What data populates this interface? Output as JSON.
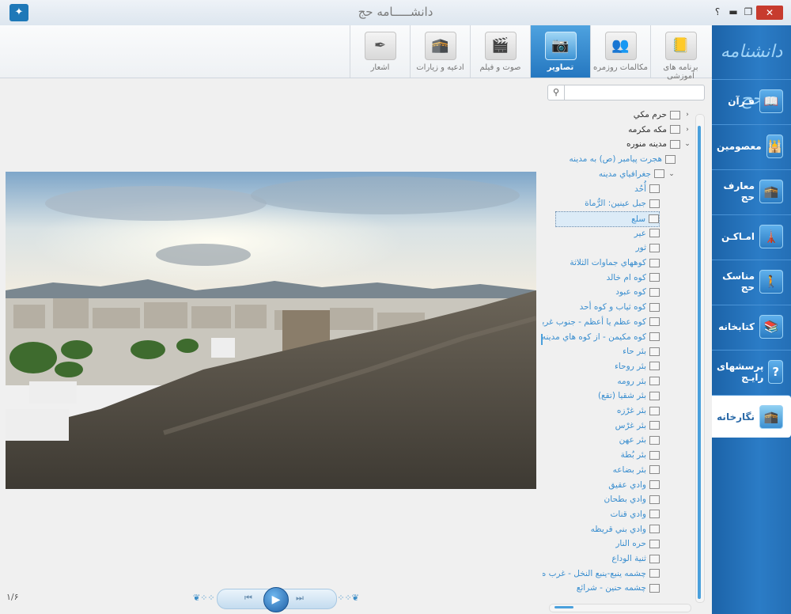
{
  "window": {
    "title": "دانشـــــامه حج",
    "help": "؟",
    "minimize": "▬",
    "maximize": "❐",
    "close": "✕",
    "app_icon": "calligraphy-logo-icon"
  },
  "sidebar": {
    "logo_text": "دانشنامه حج",
    "items": [
      {
        "label": "قـرآن",
        "icon": "quran-book-icon",
        "glyph": "📖"
      },
      {
        "label": "معصومین",
        "icon": "mosque-icon",
        "glyph": "🕌"
      },
      {
        "label": "معارف حج",
        "icon": "kaaba-icon",
        "glyph": "🕋"
      },
      {
        "label": "امـاکـن",
        "icon": "minaret-icon",
        "glyph": "🗼"
      },
      {
        "label": "مناسک حج",
        "icon": "pilgrim-icon",
        "glyph": "🚶"
      },
      {
        "label": "کتابخانه",
        "icon": "library-icon",
        "glyph": "📚"
      },
      {
        "label": "پرسشهای رایـج",
        "icon": "question-icon",
        "glyph": "?"
      },
      {
        "label": "نگارخانه",
        "icon": "gallery-icon",
        "glyph": "🕋"
      }
    ],
    "active_index": 7
  },
  "toolbar": {
    "tabs": [
      {
        "label": "برنامه های آموزشی",
        "icon": "notebook-icon",
        "glyph": "📒"
      },
      {
        "label": "مکالمات روزمره",
        "icon": "conversation-icon",
        "glyph": "👥"
      },
      {
        "label": "تصاویر",
        "icon": "camera-icon",
        "glyph": "📷"
      },
      {
        "label": "صوت و فیلم",
        "icon": "film-icon",
        "glyph": "🎬"
      },
      {
        "label": "ادعیه و زیارات",
        "icon": "prayer-icon",
        "glyph": "🕋"
      },
      {
        "label": "اشعار",
        "icon": "quill-book-icon",
        "glyph": "✒"
      }
    ],
    "active_index": 2
  },
  "search": {
    "placeholder": "",
    "value": "",
    "icon": "search-icon",
    "glyph": "⚲"
  },
  "tree": {
    "nodes": [
      {
        "label": "حرم مكي",
        "level": 0,
        "toggle": "›",
        "style": "dark"
      },
      {
        "label": "مكه مكرمه",
        "level": 0,
        "toggle": "›",
        "style": "dark"
      },
      {
        "label": "مدينه منوره",
        "level": 0,
        "toggle": "⌄",
        "style": "dark"
      },
      {
        "label": "هجرت پيامبر (ص) به مدينه",
        "level": 1,
        "toggle": "",
        "style": "link"
      },
      {
        "label": "جغرافياي مدينه",
        "level": 1,
        "toggle": "⌄",
        "style": "link"
      },
      {
        "label": "أُحُد",
        "level": 2,
        "toggle": "",
        "style": "link"
      },
      {
        "label": "جبل عينين: الرُّماة",
        "level": 2,
        "toggle": "",
        "style": "link"
      },
      {
        "label": "سلع",
        "level": 2,
        "toggle": "",
        "style": "link",
        "selected": true
      },
      {
        "label": "عير",
        "level": 2,
        "toggle": "",
        "style": "link"
      },
      {
        "label": "ثور",
        "level": 2,
        "toggle": "",
        "style": "link"
      },
      {
        "label": "كوههاي جماوات الثلاثة",
        "level": 2,
        "toggle": "",
        "style": "link"
      },
      {
        "label": "كوه ام خالد",
        "level": 2,
        "toggle": "",
        "style": "link"
      },
      {
        "label": "كوه عبود",
        "level": 2,
        "toggle": "",
        "style": "link"
      },
      {
        "label": "كوه ثياب و كوه أحد",
        "level": 2,
        "toggle": "",
        "style": "link"
      },
      {
        "label": "كوه عظم يا أعظم - جنوب غربي",
        "level": 2,
        "toggle": "",
        "style": "link"
      },
      {
        "label": "كوه مكيمن - از كوه هاي مدينه",
        "level": 2,
        "toggle": "",
        "style": "link"
      },
      {
        "label": "بئر حاء",
        "level": 2,
        "toggle": "",
        "style": "link"
      },
      {
        "label": "بئر روحاء",
        "level": 2,
        "toggle": "",
        "style": "link"
      },
      {
        "label": "بئر رومه",
        "level": 2,
        "toggle": "",
        "style": "link"
      },
      {
        "label": "بئر شقيا (تقع)",
        "level": 2,
        "toggle": "",
        "style": "link"
      },
      {
        "label": "بئر غرْزه",
        "level": 2,
        "toggle": "",
        "style": "link"
      },
      {
        "label": "بئر غرْس",
        "level": 2,
        "toggle": "",
        "style": "link"
      },
      {
        "label": "بئر عهن",
        "level": 2,
        "toggle": "",
        "style": "link"
      },
      {
        "label": "بئر بُطة",
        "level": 2,
        "toggle": "",
        "style": "link"
      },
      {
        "label": "بئر بضاعه",
        "level": 2,
        "toggle": "",
        "style": "link"
      },
      {
        "label": "وادي عقيق",
        "level": 2,
        "toggle": "",
        "style": "link"
      },
      {
        "label": "وادي بطحان",
        "level": 2,
        "toggle": "",
        "style": "link"
      },
      {
        "label": "وادي قنات",
        "level": 2,
        "toggle": "",
        "style": "link"
      },
      {
        "label": "وادي بني قريظه",
        "level": 2,
        "toggle": "",
        "style": "link"
      },
      {
        "label": "حره النار",
        "level": 2,
        "toggle": "",
        "style": "link"
      },
      {
        "label": "ثنية الوداع",
        "level": 2,
        "toggle": "",
        "style": "link"
      },
      {
        "label": "چشمه ينبع-ينبع النخل - غرب ه",
        "level": 2,
        "toggle": "",
        "style": "link"
      },
      {
        "label": "چشمه حنين - شرائع",
        "level": 2,
        "toggle": "",
        "style": "link"
      }
    ],
    "node_icon": "image-icon"
  },
  "photo": {
    "caption": "",
    "description_name": "mountain-photo"
  },
  "player": {
    "prev": "⏮",
    "play": "▶",
    "next": "⏭",
    "ornament_left": "❦⁘⁘",
    "ornament_right": "⁘⁘❦"
  },
  "page_counter": "۱/۶"
}
